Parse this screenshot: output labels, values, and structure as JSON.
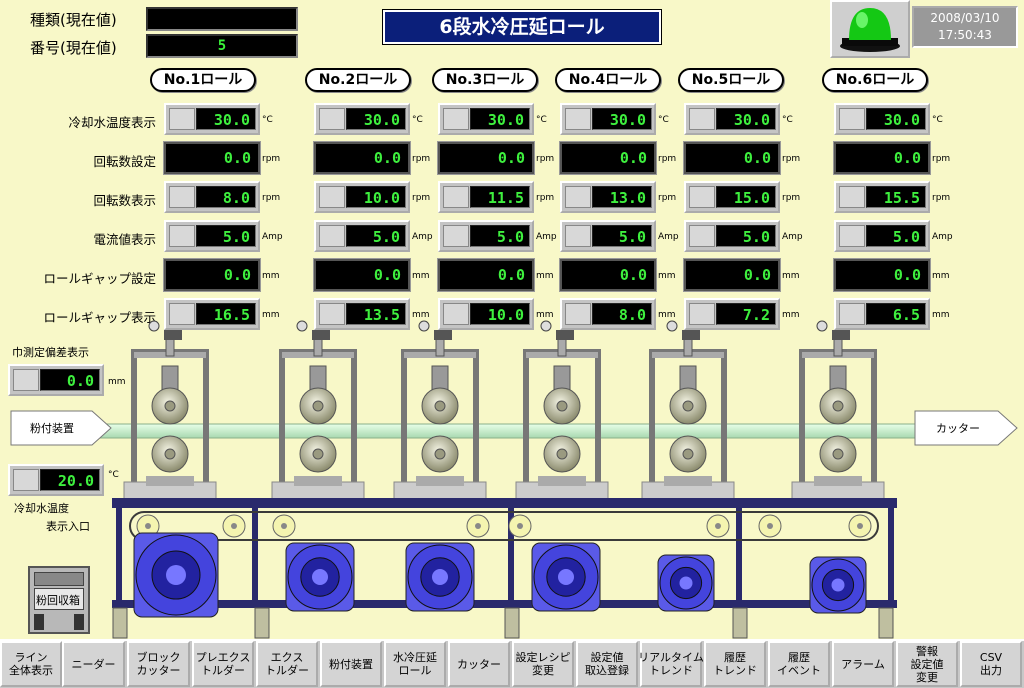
{
  "header": {
    "type_label": "種類(現在値)",
    "type_value": "",
    "number_label": "番号(現在値)",
    "number_value": "5",
    "title": "6段水冷圧延ロール",
    "date": "2008/03/10",
    "time": "17:50:43"
  },
  "rolls": [
    {
      "name": "No.1ロール",
      "cool": "30.0",
      "rpm_set": "0.0",
      "rpm": "8.0",
      "amp": "5.0",
      "gap_set": "0.0",
      "gap": "16.5"
    },
    {
      "name": "No.2ロール",
      "cool": "30.0",
      "rpm_set": "0.0",
      "rpm": "10.0",
      "amp": "5.0",
      "gap_set": "0.0",
      "gap": "13.5"
    },
    {
      "name": "No.3ロール",
      "cool": "30.0",
      "rpm_set": "0.0",
      "rpm": "11.5",
      "amp": "5.0",
      "gap_set": "0.0",
      "gap": "10.0"
    },
    {
      "name": "No.4ロール",
      "cool": "30.0",
      "rpm_set": "0.0",
      "rpm": "13.0",
      "amp": "5.0",
      "gap_set": "0.0",
      "gap": "8.0"
    },
    {
      "name": "No.5ロール",
      "cool": "30.0",
      "rpm_set": "0.0",
      "rpm": "15.0",
      "amp": "5.0",
      "gap_set": "0.0",
      "gap": "7.2"
    },
    {
      "name": "No.6ロール",
      "cool": "30.0",
      "rpm_set": "0.0",
      "rpm": "15.5",
      "amp": "5.0",
      "gap_set": "0.0",
      "gap": "6.5"
    }
  ],
  "row_labels": {
    "cool": "冷却水温度表示",
    "rpm_set": "回転数設定",
    "rpm": "回転数表示",
    "amp": "電流値表示",
    "gap_set": "ロールギャップ設定",
    "gap": "ロールギャップ表示"
  },
  "units": {
    "cool": "°C",
    "rpm_set": "rpm",
    "rpm": "rpm",
    "amp": "Amp",
    "gap_set": "mm",
    "gap": "mm"
  },
  "width_dev": {
    "label": "巾測定偏差表示",
    "value": "0.0",
    "unit": "mm"
  },
  "inlet_temp": {
    "value": "20.0",
    "unit": "°C",
    "label1": "冷却水温度",
    "label2": "表示入口"
  },
  "flow": {
    "left": "粉付装置",
    "right": "カッター"
  },
  "collector": {
    "label": "粉回収箱"
  },
  "buttons": [
    "ライン\n全体表示",
    "ニーダー",
    "ブロック\nカッター",
    "プレエクス\nトルダー",
    "エクス\nトルダー",
    "粉付装置",
    "水冷圧延\nロール",
    "カッター",
    "設定レシピ\n変更",
    "設定値\n取込登録",
    "リアルタイム\nトレンド",
    "履歴\nトレンド",
    "履歴\nイベント",
    "アラーム",
    "警報\n設定値\n変更",
    "CSV\n出力"
  ]
}
